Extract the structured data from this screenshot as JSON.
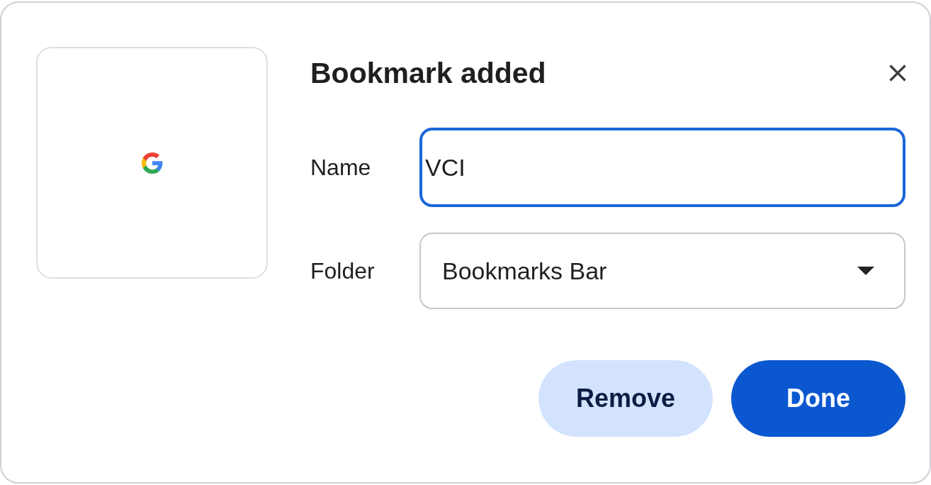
{
  "dialog": {
    "title": "Bookmark added",
    "fields": [
      {
        "kind": "text",
        "label": "Name",
        "value": "VCI",
        "focused": true
      },
      {
        "kind": "select",
        "label": "Folder",
        "value": "Bookmarks Bar",
        "focused": false
      }
    ],
    "buttons": [
      {
        "label": "Remove",
        "kind": "secondary"
      },
      {
        "label": "Done",
        "kind": "primary"
      }
    ]
  }
}
